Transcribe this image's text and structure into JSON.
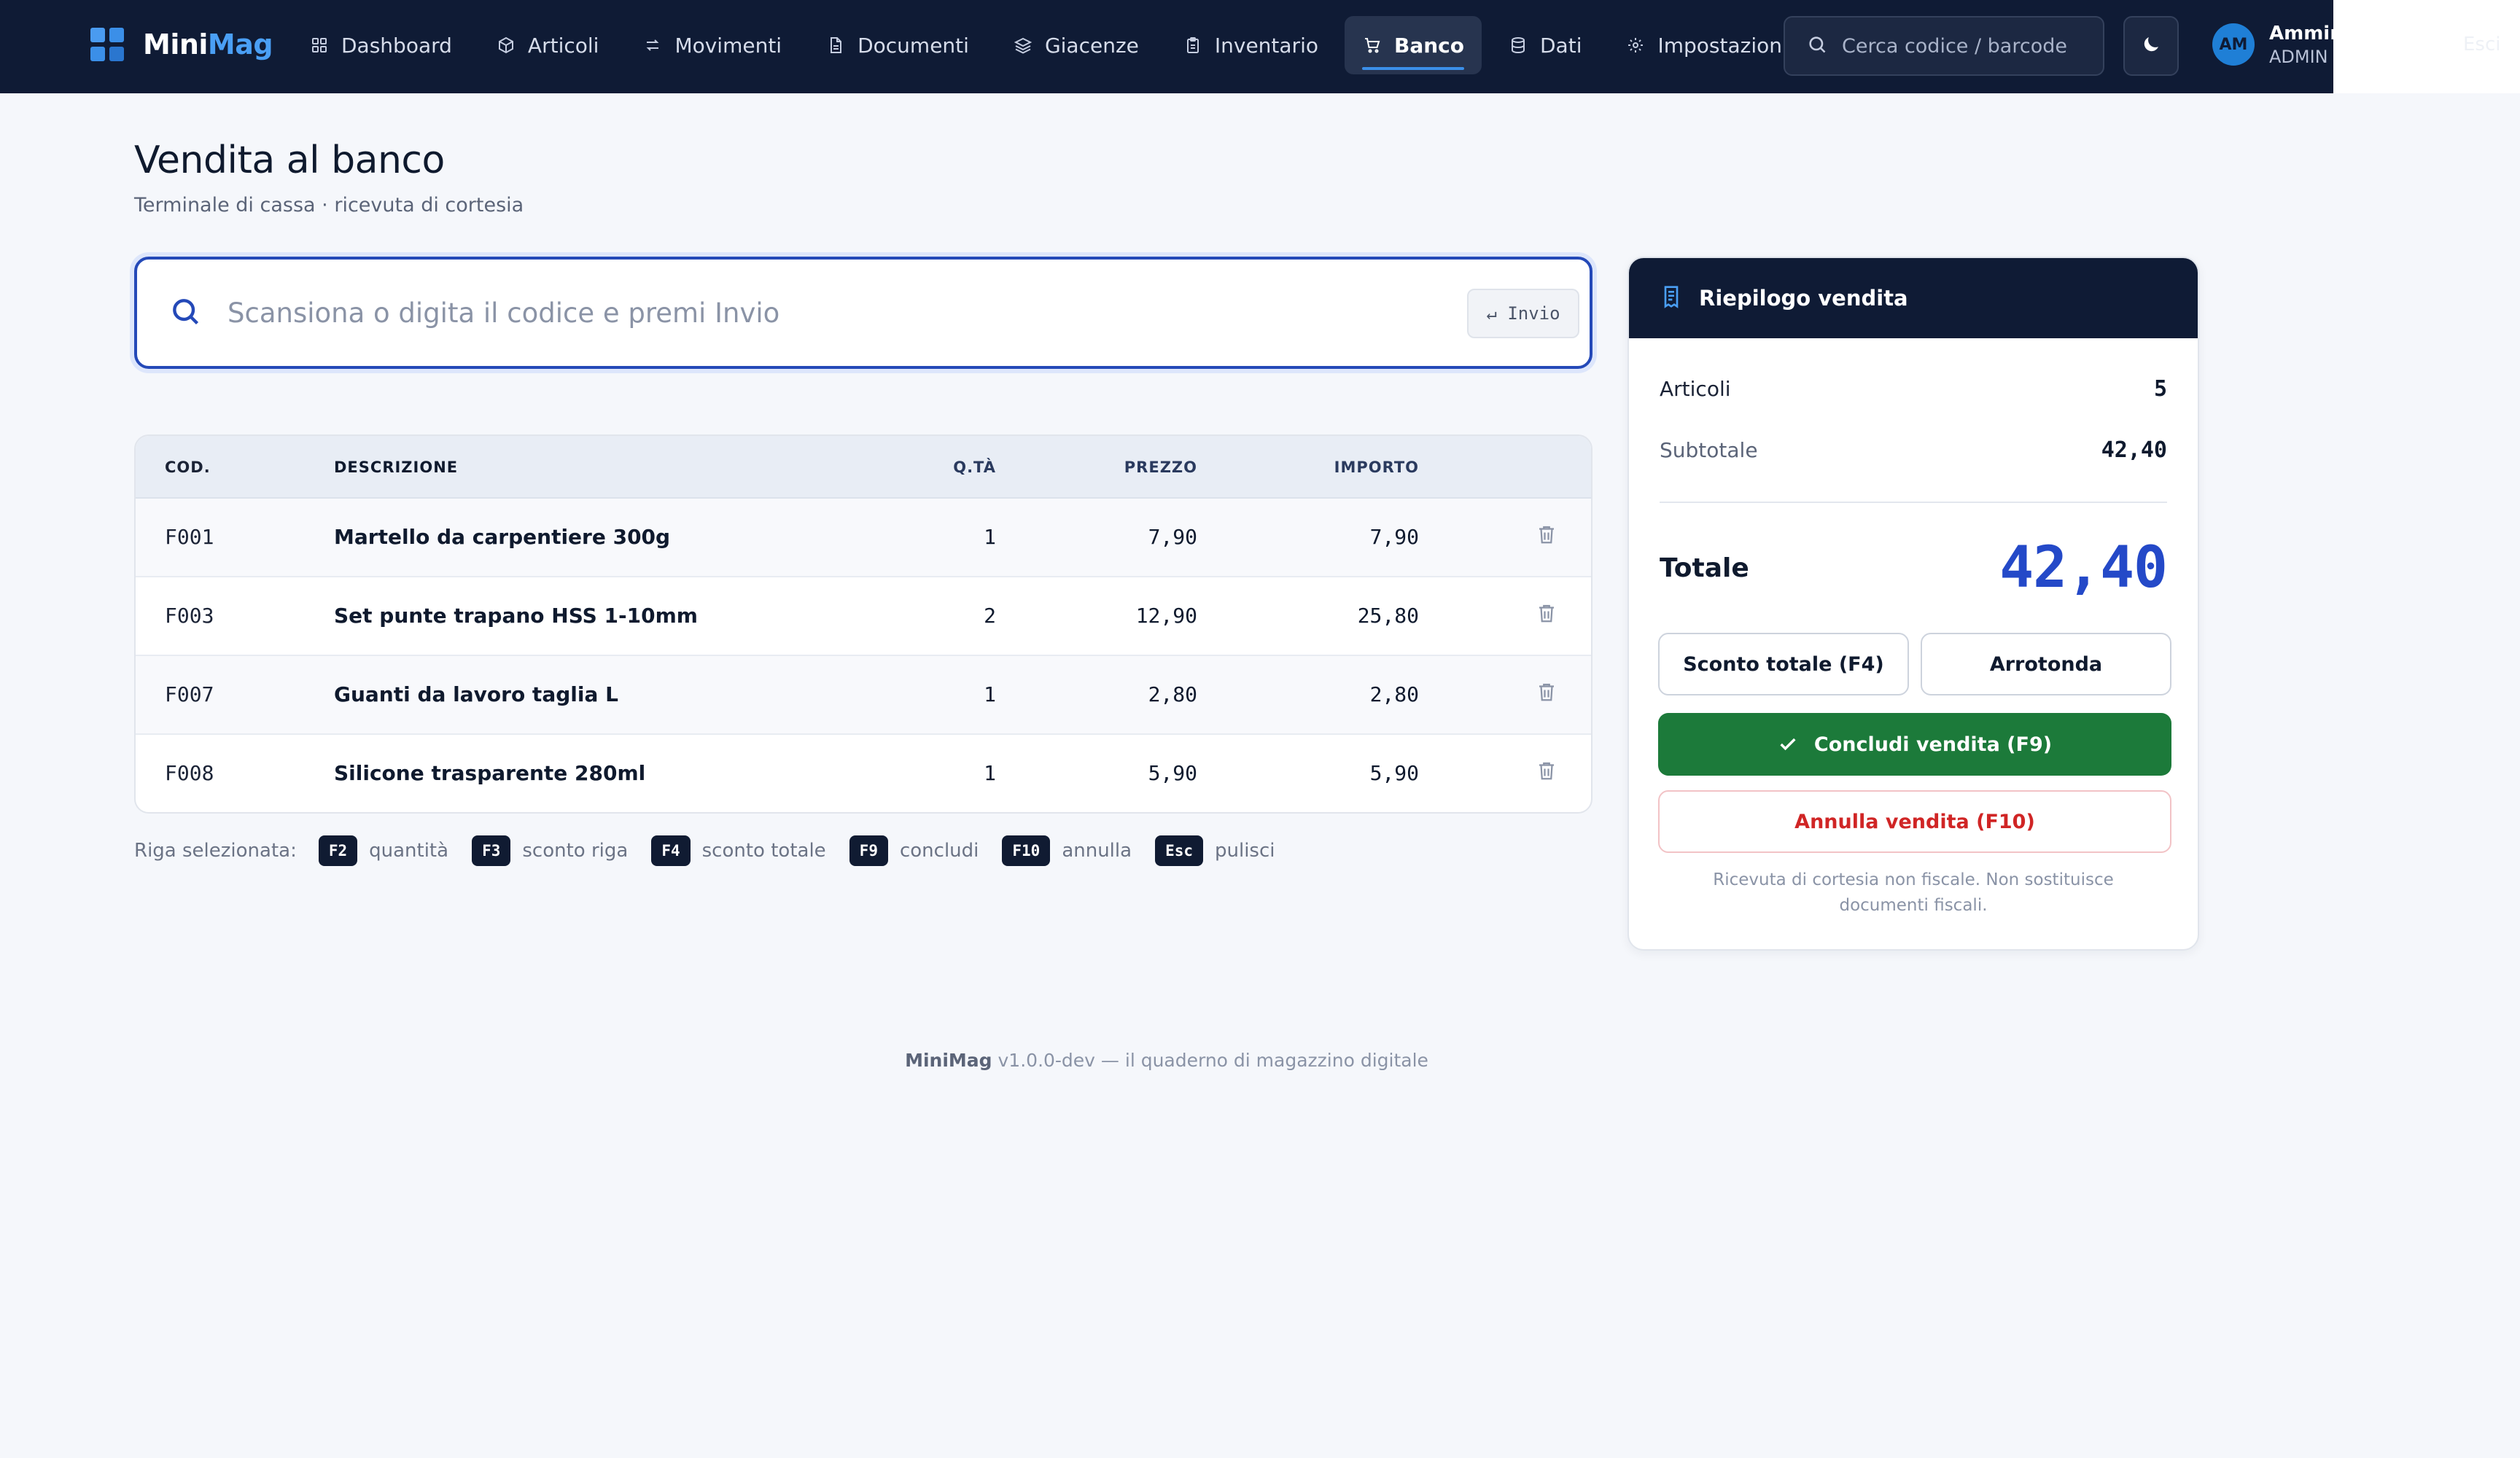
{
  "brand": {
    "part1": "Mini",
    "part2": "Mag"
  },
  "nav": [
    {
      "id": "dashboard",
      "label": "Dashboard",
      "icon": "grid-icon"
    },
    {
      "id": "articoli",
      "label": "Articoli",
      "icon": "box-icon"
    },
    {
      "id": "movimenti",
      "label": "Movimenti",
      "icon": "arrows-swap-icon"
    },
    {
      "id": "documenti",
      "label": "Documenti",
      "icon": "document-icon"
    },
    {
      "id": "giacenze",
      "label": "Giacenze",
      "icon": "layers-icon"
    },
    {
      "id": "inventario",
      "label": "Inventario",
      "icon": "clipboard-icon"
    },
    {
      "id": "banco",
      "label": "Banco",
      "icon": "cart-icon",
      "active": true
    },
    {
      "id": "dati",
      "label": "Dati",
      "icon": "database-icon"
    },
    {
      "id": "impostazioni",
      "label": "Impostazioni",
      "icon": "gear-icon"
    }
  ],
  "header": {
    "search_placeholder": "Cerca codice / barcode",
    "user_initials": "AM",
    "user_name": "Amministratore",
    "user_role": "ADMIN",
    "logout_label": "Esci"
  },
  "page": {
    "title": "Vendita al banco",
    "subtitle": "Terminale di cassa · ricevuta di cortesia"
  },
  "scan": {
    "placeholder": "Scansiona o digita il codice e premi Invio",
    "enter_label": "↵ Invio"
  },
  "table": {
    "columns": {
      "code": "COD.",
      "desc": "DESCRIZIONE",
      "qty": "Q.TÀ",
      "price": "PREZZO",
      "amount": "IMPORTO"
    },
    "rows": [
      {
        "code": "F001",
        "desc": "Martello da carpentiere 300g",
        "qty": "1",
        "price": "7,90",
        "amount": "7,90"
      },
      {
        "code": "F003",
        "desc": "Set punte trapano HSS 1-10mm",
        "qty": "2",
        "price": "12,90",
        "amount": "25,80"
      },
      {
        "code": "F007",
        "desc": "Guanti da lavoro taglia L",
        "qty": "1",
        "price": "2,80",
        "amount": "2,80"
      },
      {
        "code": "F008",
        "desc": "Silicone trasparente 280ml",
        "qty": "1",
        "price": "5,90",
        "amount": "5,90"
      }
    ]
  },
  "shortcuts": {
    "label": "Riga selezionata:",
    "items": [
      {
        "key": "F2",
        "text": "quantità"
      },
      {
        "key": "F3",
        "text": "sconto riga"
      },
      {
        "key": "F4",
        "text": "sconto totale"
      },
      {
        "key": "F9",
        "text": "concludi"
      },
      {
        "key": "F10",
        "text": "annulla"
      },
      {
        "key": "Esc",
        "text": "pulisci"
      }
    ]
  },
  "summary": {
    "title": "Riepilogo vendita",
    "items_label": "Articoli",
    "items_value": "5",
    "subtotal_label": "Subtotale",
    "subtotal_value": "42,40",
    "total_label": "Totale",
    "total_value": "42,40",
    "discount_button": "Sconto totale (F4)",
    "round_button": "Arrotonda",
    "confirm_button": "Concludi vendita (F9)",
    "cancel_button": "Annulla vendita (F10)",
    "note": "Ricevuta di cortesia non fiscale. Non sostituisce documenti fiscali."
  },
  "footer": {
    "brand": "MiniMag",
    "text": " v1.0.0-dev — il quaderno di magazzino digitale"
  },
  "colors": {
    "nav_bg": "#0f1b35",
    "accent": "#2449c8",
    "confirm": "#1c7a3a",
    "danger": "#d02525"
  }
}
